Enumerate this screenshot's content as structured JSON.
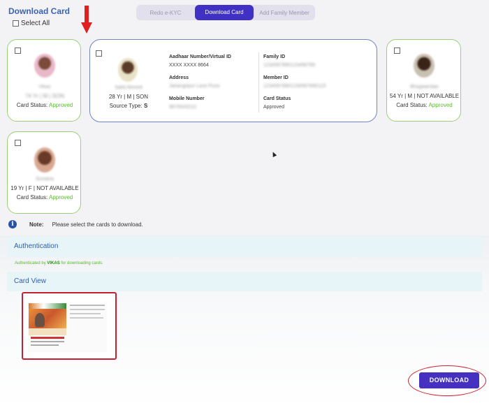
{
  "page": {
    "title": "Download Card",
    "select_all_label": "Select All"
  },
  "tabs": [
    {
      "label": "Redo e-KYC",
      "active": false
    },
    {
      "label": "Download Card",
      "active": true
    },
    {
      "label": "Add Family Member",
      "active": false
    }
  ],
  "cards": [
    {
      "name": "Vikas",
      "info": "74 Yr | M | SON",
      "status_label": "Card Status:",
      "status": "Approved"
    },
    {
      "name": "Sahil Ahmed",
      "info": "28 Yr | M | SON",
      "source_label": "Source Type:",
      "source": "S",
      "aadhaar_label": "Aadhaar Number/Virtual ID",
      "aadhaar": "XXXX XXXX 8664",
      "address_label": "Address",
      "address": "Jahangirpur Lane Pune",
      "mobile_label": "Mobile Number",
      "mobile": "9876543210",
      "family_id_label": "Family ID",
      "family_id": "1234567890123456789",
      "member_id_label": "Member ID",
      "member_id": "12345678901234567890123",
      "card_status_label": "Card Status",
      "card_status": "Approved"
    },
    {
      "name": "Bhagwandas",
      "info": "54 Yr | M | NOT AVAILABLE",
      "status_label": "Card Status:",
      "status": "Approved"
    },
    {
      "name": "Sunaina",
      "info": "19 Yr | F | NOT AVAILABLE",
      "status_label": "Card Status:",
      "status": "Approved"
    }
  ],
  "note": {
    "label": "Note:",
    "text": "Please select the cards to download."
  },
  "authentication": {
    "header": "Authentication",
    "text_before": "Authenticated by",
    "user": "VIKAS",
    "text_after": "for downloading cards."
  },
  "card_view": {
    "header": "Card View"
  },
  "download_button": "DOWNLOAD",
  "colors": {
    "accent": "#4130c4",
    "approved": "#5cb833",
    "header_text": "#2e5fae"
  }
}
